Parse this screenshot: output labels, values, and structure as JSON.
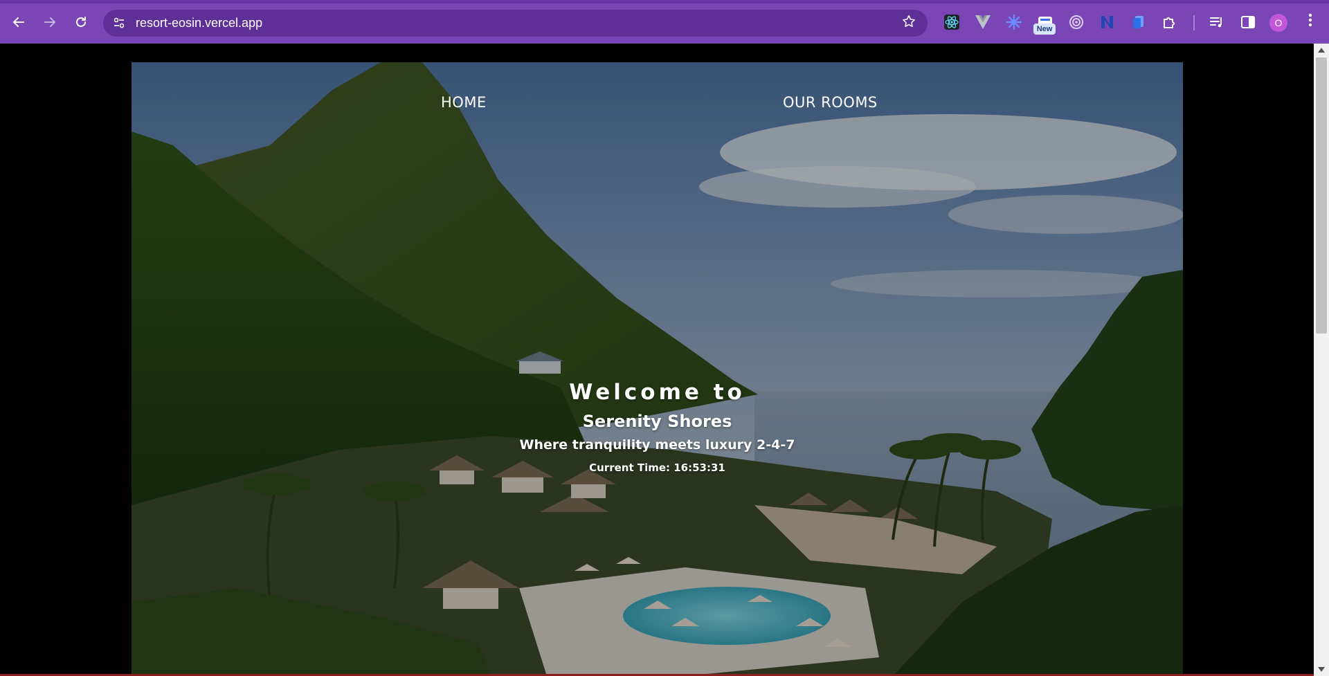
{
  "browser": {
    "url": "resort-eosin.vercel.app",
    "back_icon": "arrow-left-icon",
    "forward_icon": "arrow-right-icon",
    "reload_icon": "reload-icon",
    "bookmark_icon": "star-icon",
    "new_badge": "New",
    "profile_initial": "O",
    "extensions": [
      "react-devtools-icon",
      "vue-devtools-icon",
      "sparkle-extension-icon",
      "new-extension-icon",
      "target-extension-icon",
      "n-extension-icon",
      "copy-extension-icon",
      "puzzle-extensions-icon",
      "media-controls-icon",
      "side-panel-icon"
    ],
    "accent_color": "#7a46b6"
  },
  "nav": {
    "home": "HOME",
    "rooms": "OUR ROOMS"
  },
  "hero": {
    "welcome": "Welcome to",
    "name": "Serenity Shores",
    "tagline": "Where tranquility meets luxury 2-4-7",
    "time": "Current Time: 16:53:31"
  }
}
